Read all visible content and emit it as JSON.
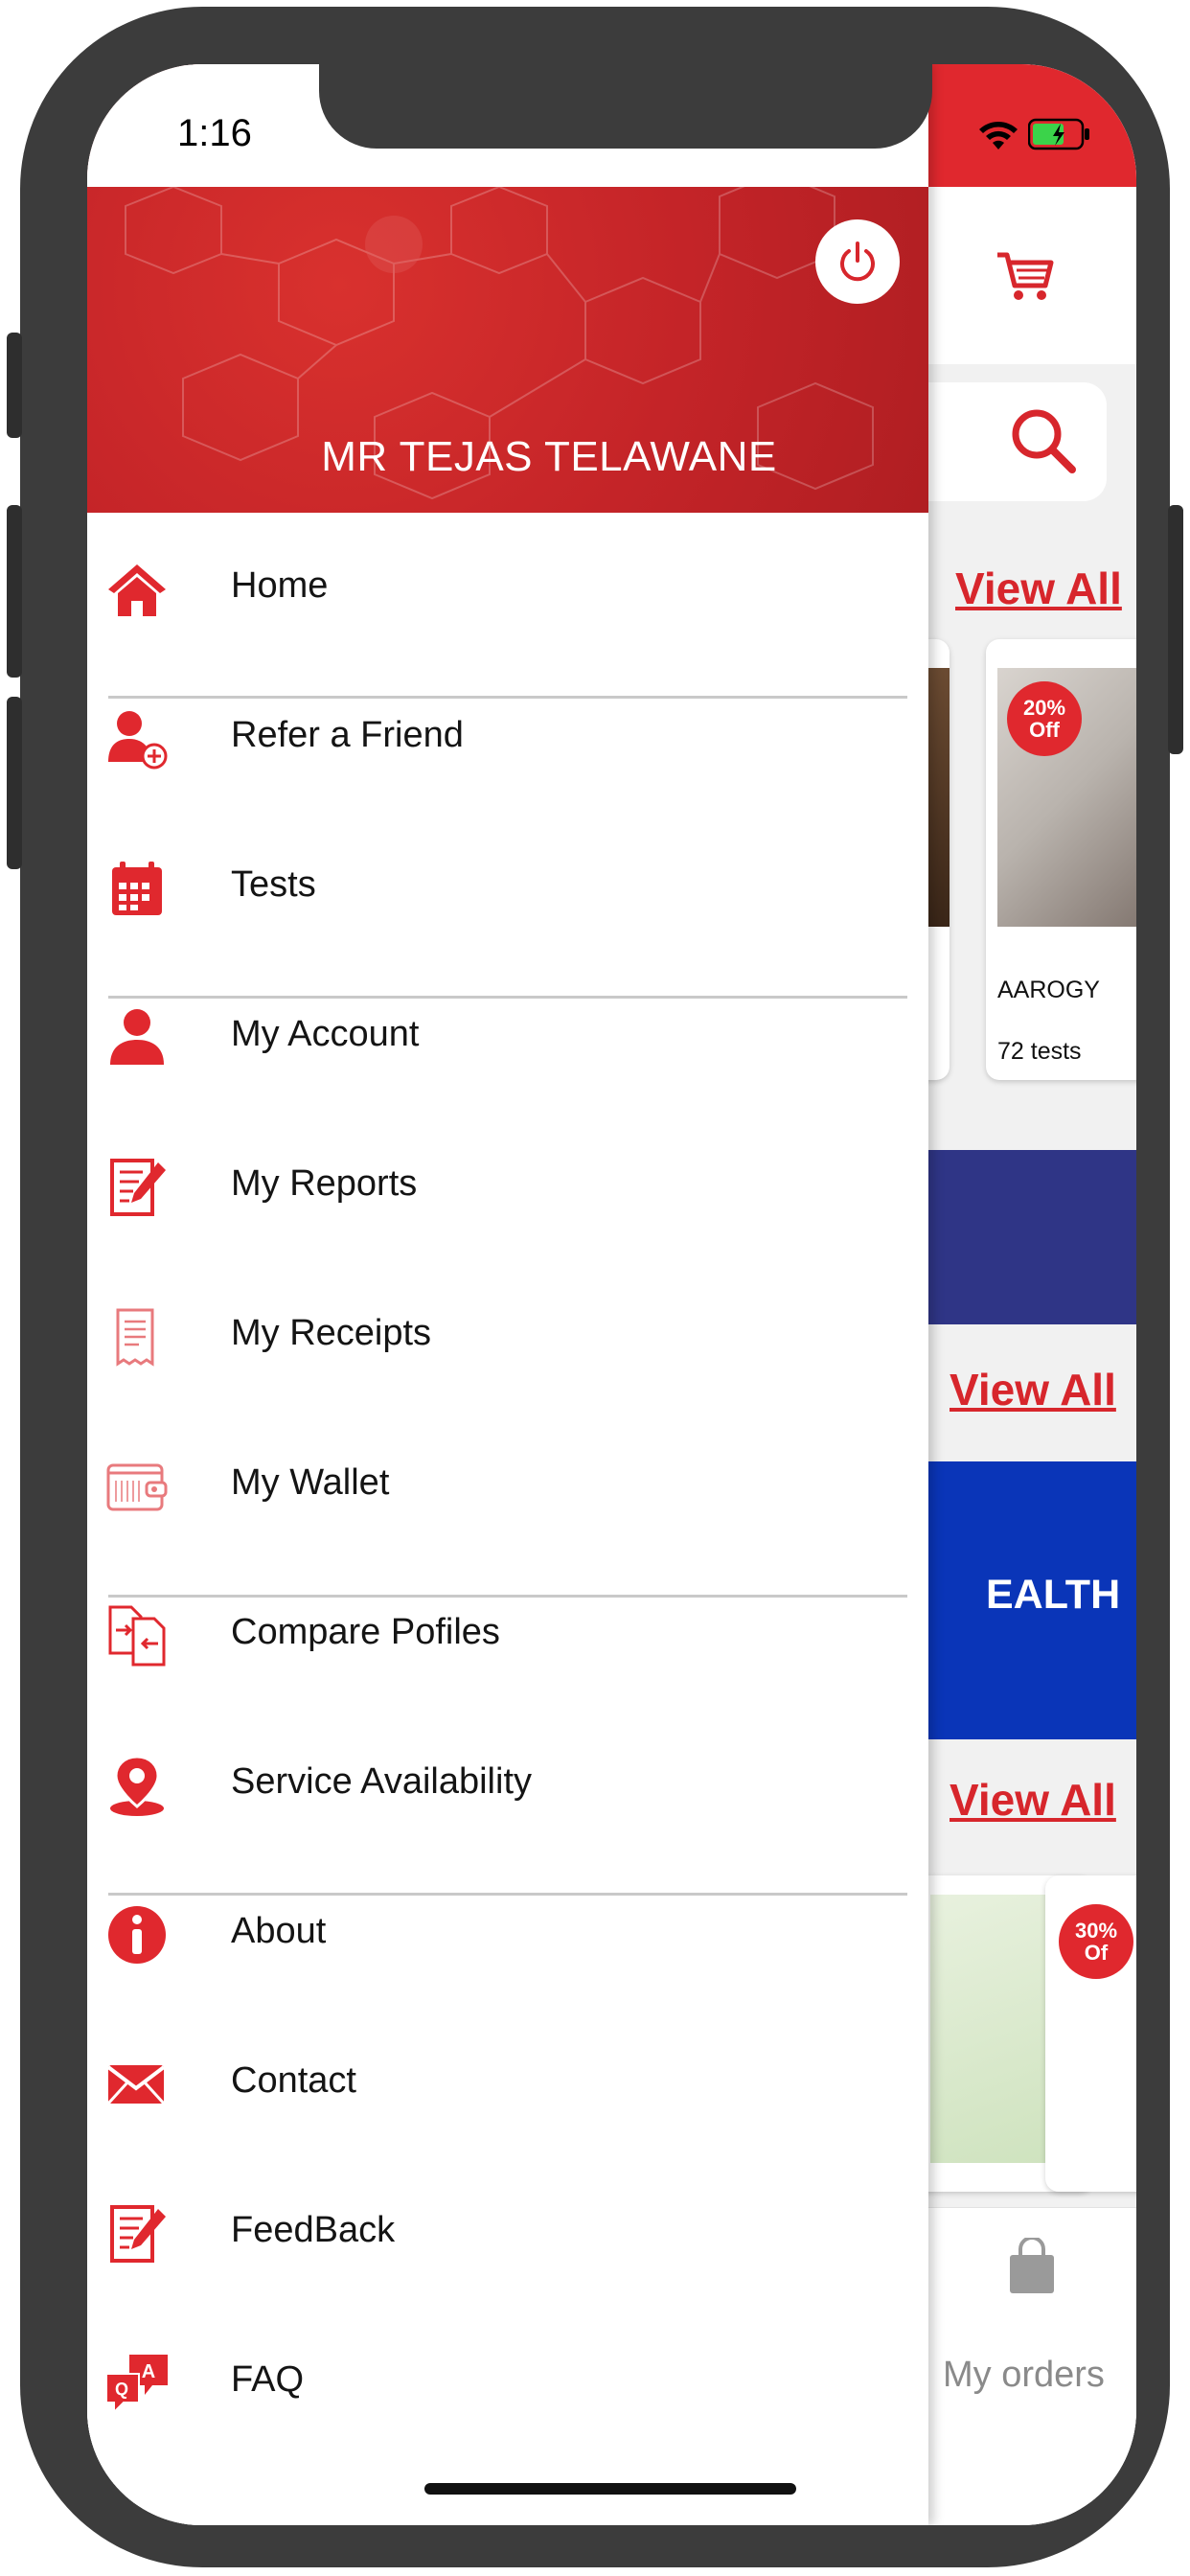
{
  "status_bar": {
    "time": "1:16"
  },
  "drawer": {
    "user_name": "MR TEJAS TELAWANE",
    "menu": [
      {
        "label": "Home",
        "icon": "home-icon"
      },
      {
        "label": "Refer a Friend",
        "icon": "add-user-icon"
      },
      {
        "label": "Tests",
        "icon": "calendar-icon"
      },
      {
        "label": "My Account",
        "icon": "user-icon"
      },
      {
        "label": "My Reports",
        "icon": "report-icon"
      },
      {
        "label": "My Receipts",
        "icon": "receipt-icon"
      },
      {
        "label": "My Wallet",
        "icon": "wallet-icon"
      },
      {
        "label": "Compare Pofiles",
        "icon": "compare-icon"
      },
      {
        "label": "Service Availability",
        "icon": "location-pin-icon"
      },
      {
        "label": "About",
        "icon": "info-icon"
      },
      {
        "label": "Contact",
        "icon": "mail-icon"
      },
      {
        "label": "FeedBack",
        "icon": "feedback-icon"
      },
      {
        "label": "FAQ",
        "icon": "faq-icon"
      }
    ]
  },
  "background_app": {
    "view_all_label": "View All",
    "package_card": {
      "badge_percent": "20%",
      "badge_off": "Off",
      "name": "AAROGY",
      "tests": "72 tests"
    },
    "package_card_2": {
      "badge_percent": "30%",
      "badge_off": "Of"
    },
    "banner_text": "EALTH",
    "tab_label": "My orders"
  },
  "colors": {
    "accent": "#e0282e",
    "header_red": "#c42428",
    "banner_purple": "#2f3586",
    "banner_blue": "#0a35b8"
  }
}
